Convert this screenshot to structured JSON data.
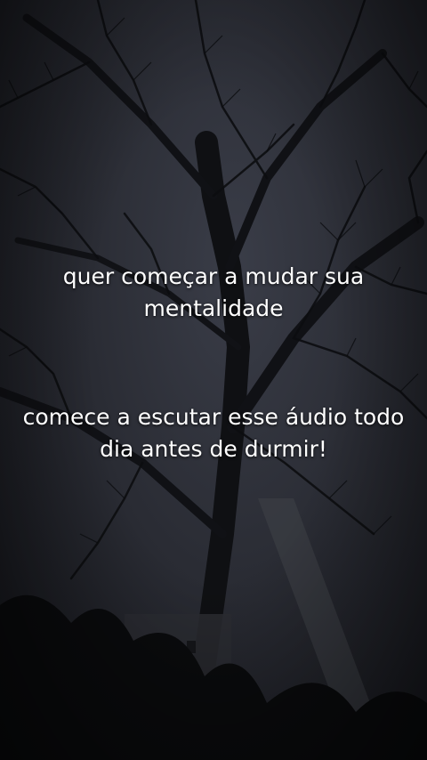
{
  "caption": {
    "line1a": "quer começar a mudar sua",
    "line1b": "mentalidade",
    "line2a": "comece a escutar esse áudio todo",
    "line2b": "dia antes de durmir!"
  },
  "colors": {
    "sky": "#2a2c34",
    "branches": "#0e0f12",
    "text": "#ffffff"
  }
}
